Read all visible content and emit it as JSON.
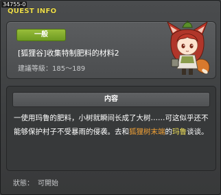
{
  "window": {
    "quest_id": "34755-0",
    "title": "QUEST INFO"
  },
  "quest": {
    "category": "一般",
    "name": "[狐狸谷]收集特制肥料的材料2",
    "level_label": "建議等級",
    "level_range": "185～189"
  },
  "content": {
    "header": "内容",
    "text_1": "一使用玛鲁的肥料，小树就瞬间长成了大树……可这似乎还不能够保护村子不受暴雨的侵袭。去和",
    "highlight_location": "狐狸树末端",
    "text_2": "的",
    "highlight_npc": "玛鲁",
    "text_3": "谈谈。"
  },
  "status": {
    "label": "狀態：",
    "value": "可開始"
  },
  "colors": {
    "title": "#f0e04c",
    "badge": "#86ab2e",
    "location_highlight": "#f0a035",
    "npc_highlight": "#f3e25a"
  }
}
